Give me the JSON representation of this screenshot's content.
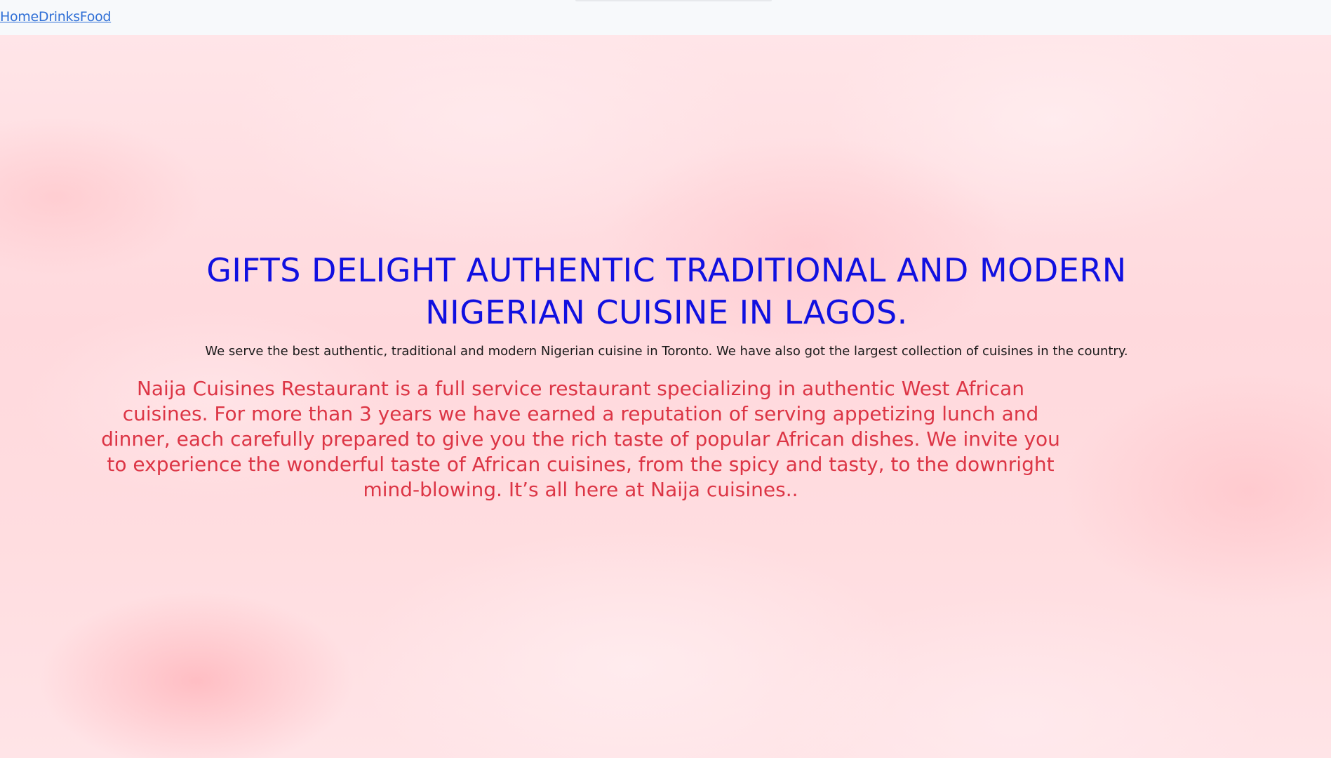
{
  "nav": {
    "links": [
      "Home",
      "Drinks",
      "Food"
    ]
  },
  "hero": {
    "title": "GIFTS DELIGHT AUTHENTIC TRADITIONAL AND MODERN NIGERIAN CUISINE IN LAGOS.",
    "subtitle": "We serve the best authentic, traditional and modern Nigerian cuisine in Toronto. We have also got the largest collection of cuisines in the country.",
    "intro": "Naija Cuisines Restaurant is a full service restaurant specializing in authentic West African cuisines. For more than 3 years we have earned a reputation of serving appetizing lunch and dinner, each carefully prepared to give you the rich taste of popular African dishes. We invite you to experience the wonderful taste of African cuisines, from the spicy and tasty, to the downright mind-blowing. It’s all here at Naija cuisines.."
  },
  "colors": {
    "link": "#2f6fd6",
    "title": "#1010e0",
    "intro": "#dc3545",
    "background": "#ffe3e6"
  }
}
